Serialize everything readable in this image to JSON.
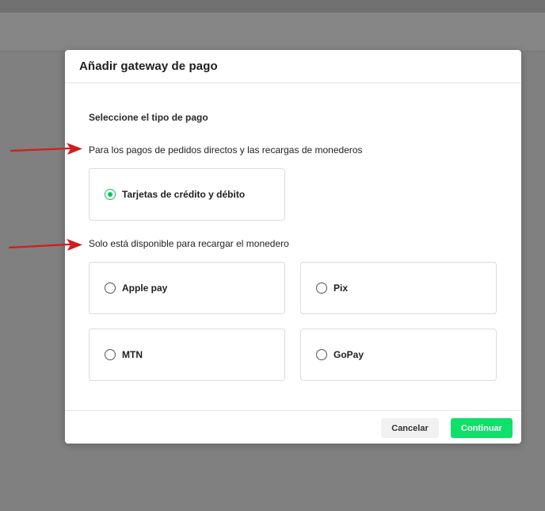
{
  "modal": {
    "title": "Añadir gateway de pago",
    "section_title": "Seleccione el tipo de pago",
    "description_direct": "Para los pagos de pedidos directos y las recargas de monederos",
    "description_wallet": "Solo está disponible para recargar el monedero",
    "options_direct": [
      {
        "label": "Tarjetas de crédito y débito",
        "selected": true
      }
    ],
    "options_wallet": [
      {
        "label": "Apple pay",
        "selected": false
      },
      {
        "label": "Pix",
        "selected": false
      },
      {
        "label": "MTN",
        "selected": false
      },
      {
        "label": "GoPay",
        "selected": false
      }
    ],
    "footer": {
      "cancel_label": "Cancelar",
      "continue_label": "Continuar"
    }
  },
  "colors": {
    "accent": "#0ee06a",
    "radio_selected": "#0bc45e",
    "annotation_arrow": "#d41c1c",
    "overlay": "#808080"
  },
  "icons": {
    "annotation": "red-arrow-icon",
    "radio_selected": "radio-checked-icon",
    "radio_unselected": "radio-unchecked-icon"
  }
}
